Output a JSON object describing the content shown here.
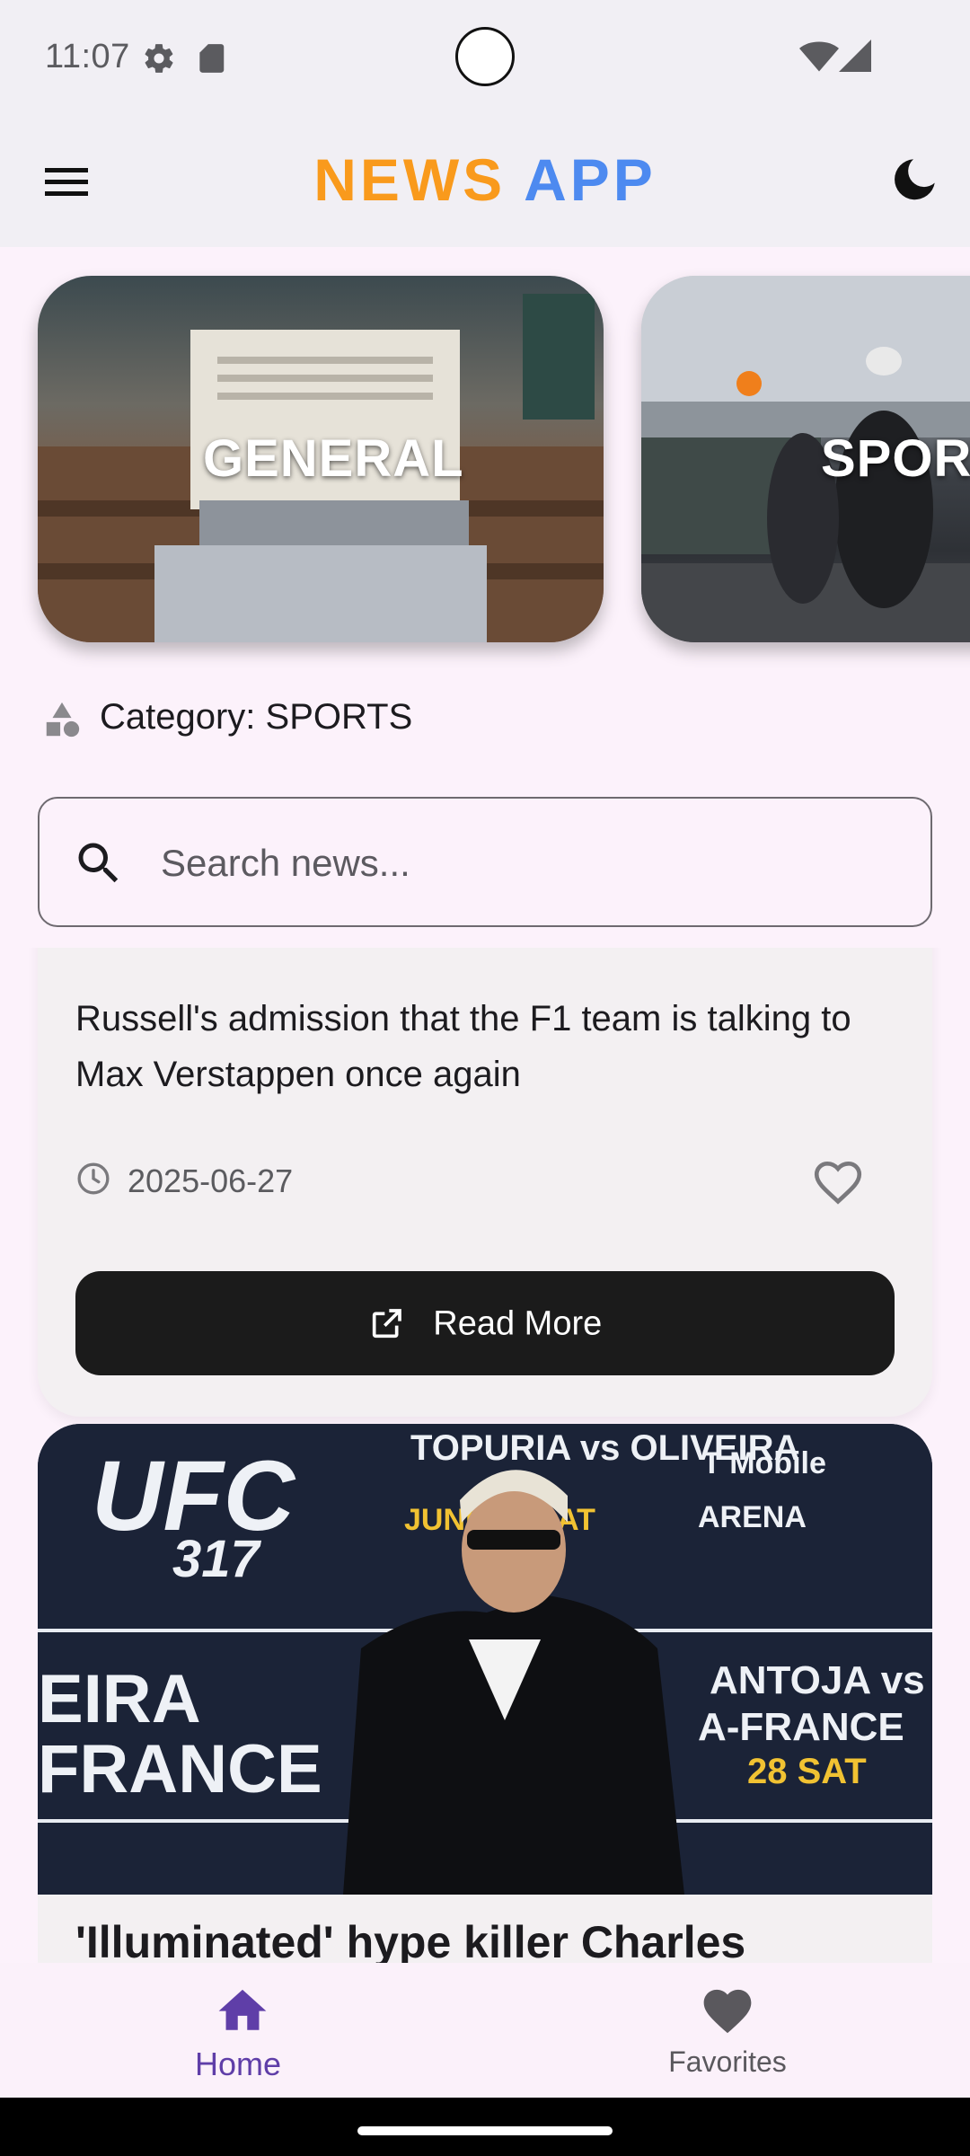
{
  "status_bar": {
    "time": "11:07",
    "icons": [
      "settings-gear-icon",
      "sd-card-icon",
      "wifi-icon",
      "cell-signal-icon"
    ]
  },
  "app_bar": {
    "title_part1": "NEWS",
    "title_part2": "APP",
    "menu_icon": "hamburger-menu-icon",
    "theme_icon": "moon-icon",
    "colors": {
      "title_part1": "#F99A1C",
      "title_part2": "#4D8AF0"
    }
  },
  "categories": [
    {
      "label": "GENERAL"
    },
    {
      "label": "SPORTS"
    }
  ],
  "current_category": {
    "text": "Category: SPORTS",
    "icon": "category-shapes-icon"
  },
  "search": {
    "placeholder": "Search news...",
    "value": "",
    "icon": "search-icon"
  },
  "articles": [
    {
      "description": "Russell's admission that the F1 team is talking to Max Verstappen once again",
      "date": "2025-06-27",
      "date_icon": "clock-icon",
      "favorite_icon": "heart-outline-icon",
      "button_label": "Read More",
      "button_icon": "open-external-icon"
    },
    {
      "title": "'Illuminated' hype killer Charles",
      "image_text": {
        "ufc": "UFC",
        "event_number": "317",
        "headline": "TOPURIA vs OLIVEIRA",
        "date": "JUNE 28 SAT",
        "venue_brand": "T Mobile",
        "venue": "ARENA",
        "left_name_1": "EIRA",
        "left_name_2": "FRANCE",
        "right_name_1": "ANTOJA vs",
        "right_name_2": "A-FRANCE",
        "right_date": "28 SAT"
      }
    }
  ],
  "bottom_nav": {
    "items": [
      {
        "label": "Home",
        "icon": "home-icon",
        "selected": true
      },
      {
        "label": "Favorites",
        "icon": "heart-filled-icon",
        "selected": false
      }
    ],
    "colors": {
      "selected": "#5F3EA8",
      "unselected": "#5A585D"
    }
  }
}
